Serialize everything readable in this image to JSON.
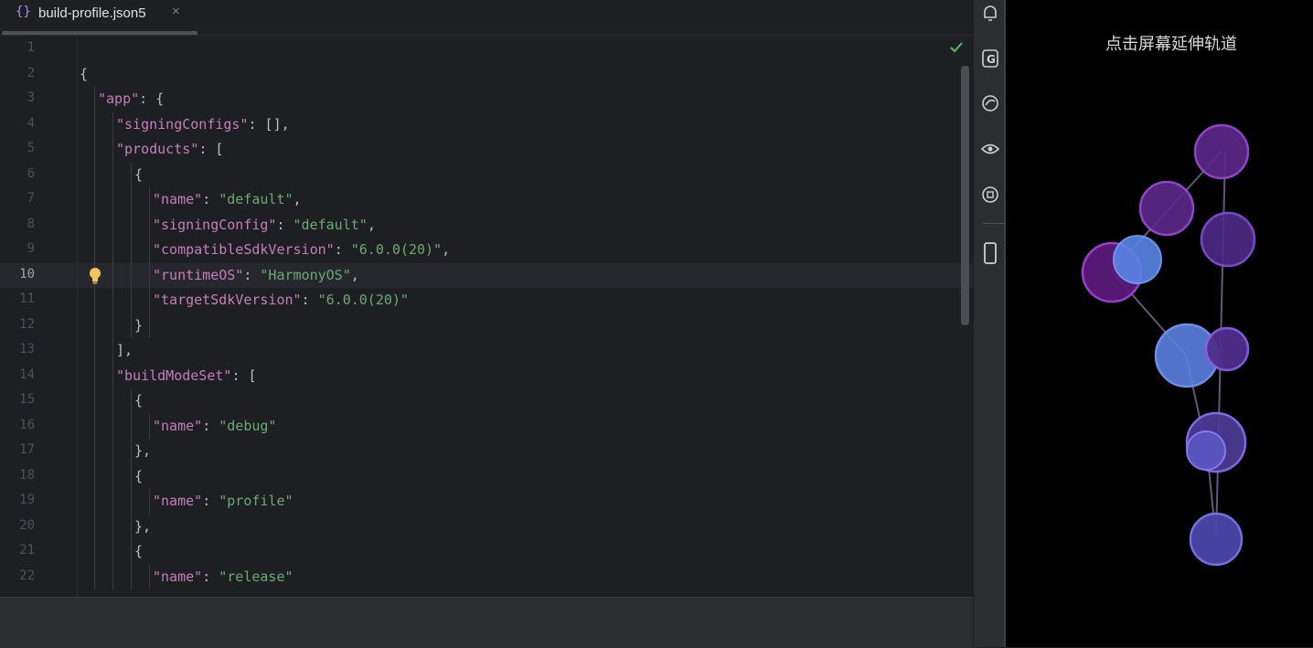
{
  "tab": {
    "icon": "{}",
    "label": "build-profile.json5",
    "close": "×"
  },
  "editor": {
    "current_line": 10,
    "lines": [
      {
        "n": "1",
        "indent": 0,
        "tokens": []
      },
      {
        "n": "2",
        "indent": 0,
        "tokens": [
          {
            "t": "p",
            "v": "{"
          }
        ]
      },
      {
        "n": "3",
        "indent": 1,
        "tokens": [
          {
            "t": "k",
            "v": "\"app\""
          },
          {
            "t": "p",
            "v": ": {"
          }
        ]
      },
      {
        "n": "4",
        "indent": 2,
        "tokens": [
          {
            "t": "k",
            "v": "\"signingConfigs\""
          },
          {
            "t": "p",
            "v": ": [],"
          }
        ]
      },
      {
        "n": "5",
        "indent": 2,
        "tokens": [
          {
            "t": "k",
            "v": "\"products\""
          },
          {
            "t": "p",
            "v": ": ["
          }
        ]
      },
      {
        "n": "6",
        "indent": 3,
        "tokens": [
          {
            "t": "p",
            "v": "{"
          }
        ]
      },
      {
        "n": "7",
        "indent": 4,
        "tokens": [
          {
            "t": "k",
            "v": "\"name\""
          },
          {
            "t": "p",
            "v": ": "
          },
          {
            "t": "s",
            "v": "\"default\""
          },
          {
            "t": "p",
            "v": ","
          }
        ]
      },
      {
        "n": "8",
        "indent": 4,
        "tokens": [
          {
            "t": "k",
            "v": "\"signingConfig\""
          },
          {
            "t": "p",
            "v": ": "
          },
          {
            "t": "s",
            "v": "\"default\""
          },
          {
            "t": "p",
            "v": ","
          }
        ]
      },
      {
        "n": "9",
        "indent": 4,
        "tokens": [
          {
            "t": "k",
            "v": "\"compatibleSdkVersion\""
          },
          {
            "t": "p",
            "v": ": "
          },
          {
            "t": "s",
            "v": "\"6.0.0(20)\""
          },
          {
            "t": "p",
            "v": ","
          }
        ]
      },
      {
        "n": "10",
        "indent": 4,
        "tokens": [
          {
            "t": "k",
            "v": "\"runtimeOS\""
          },
          {
            "t": "p",
            "v": ": "
          },
          {
            "t": "s",
            "v": "\"HarmonyOS\""
          },
          {
            "t": "p",
            "v": ","
          }
        ]
      },
      {
        "n": "11",
        "indent": 4,
        "tokens": [
          {
            "t": "k",
            "v": "\"targetSdkVersion\""
          },
          {
            "t": "p",
            "v": ": "
          },
          {
            "t": "s",
            "v": "\"6.0.0(20)\""
          }
        ]
      },
      {
        "n": "12",
        "indent": 3,
        "tokens": [
          {
            "t": "p",
            "v": "}"
          }
        ]
      },
      {
        "n": "13",
        "indent": 2,
        "tokens": [
          {
            "t": "p",
            "v": "],"
          }
        ]
      },
      {
        "n": "14",
        "indent": 2,
        "tokens": [
          {
            "t": "k",
            "v": "\"buildModeSet\""
          },
          {
            "t": "p",
            "v": ": ["
          }
        ]
      },
      {
        "n": "15",
        "indent": 3,
        "tokens": [
          {
            "t": "p",
            "v": "{"
          }
        ]
      },
      {
        "n": "16",
        "indent": 4,
        "tokens": [
          {
            "t": "k",
            "v": "\"name\""
          },
          {
            "t": "p",
            "v": ": "
          },
          {
            "t": "s",
            "v": "\"debug\""
          }
        ]
      },
      {
        "n": "17",
        "indent": 3,
        "tokens": [
          {
            "t": "p",
            "v": "},"
          }
        ]
      },
      {
        "n": "18",
        "indent": 3,
        "tokens": [
          {
            "t": "p",
            "v": "{"
          }
        ]
      },
      {
        "n": "19",
        "indent": 4,
        "tokens": [
          {
            "t": "k",
            "v": "\"name\""
          },
          {
            "t": "p",
            "v": ": "
          },
          {
            "t": "s",
            "v": "\"profile\""
          }
        ]
      },
      {
        "n": "20",
        "indent": 3,
        "tokens": [
          {
            "t": "p",
            "v": "},"
          }
        ]
      },
      {
        "n": "21",
        "indent": 3,
        "tokens": [
          {
            "t": "p",
            "v": "{"
          }
        ]
      },
      {
        "n": "22",
        "indent": 4,
        "tokens": [
          {
            "t": "k",
            "v": "\"name\""
          },
          {
            "t": "p",
            "v": ": "
          },
          {
            "t": "s",
            "v": "\"release\""
          }
        ]
      }
    ]
  },
  "toolstrip": {
    "icons": [
      "notifications-icon",
      "gemini-g-icon",
      "gauge-icon",
      "eye-icon",
      "device-manager-icon",
      "phone-preview-icon"
    ]
  },
  "device": {
    "title": "点击屏幕延伸轨道"
  },
  "colors": {
    "key": "#c77dbb",
    "string": "#6aab73",
    "punct": "#bcbec4",
    "purple_ball": "#6a2c91",
    "violet_ball": "#5b3a9a",
    "blue_ball": "#5b7fe0"
  }
}
